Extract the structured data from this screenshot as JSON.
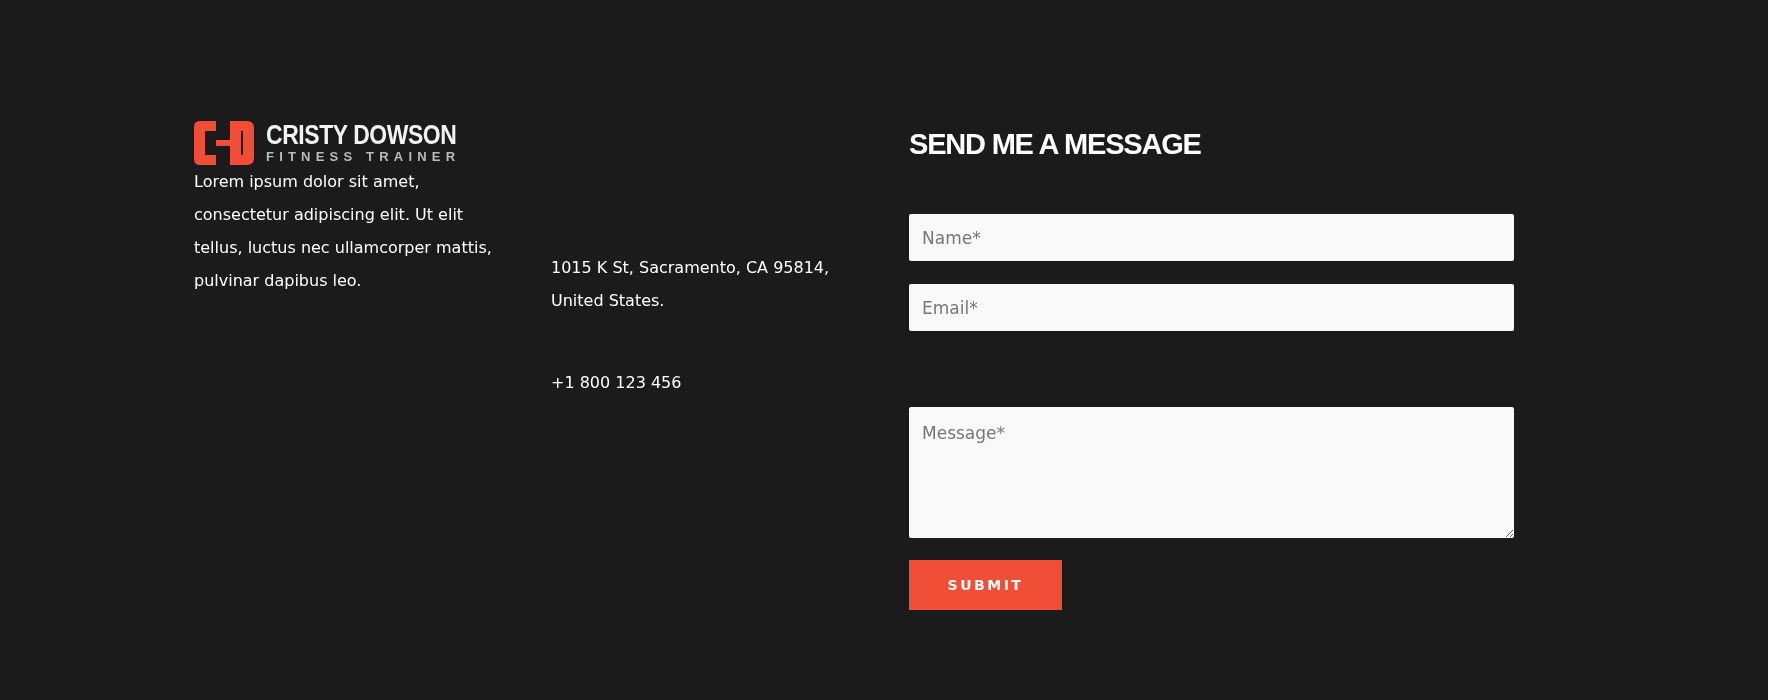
{
  "brand": {
    "name": "CRISTY DOWSON",
    "tagline": "FITNESS TRAINER"
  },
  "about": "Lorem ipsum dolor sit amet, consectetur adipiscing elit. Ut elit tellus, luctus nec ullamcorper mattis, pulvinar dapibus leo.",
  "contact": {
    "address": "1015 K St, Sacramento, CA 95814, United States.",
    "phone": "+1 800 123 456"
  },
  "form": {
    "title": "SEND ME A MESSAGE",
    "fields": [
      {
        "kind": "input",
        "placeholder": "Name*"
      },
      {
        "kind": "input",
        "placeholder": "Email*"
      },
      {
        "kind": "textarea",
        "placeholder": "Message*"
      }
    ],
    "submit": "SUBMIT"
  }
}
